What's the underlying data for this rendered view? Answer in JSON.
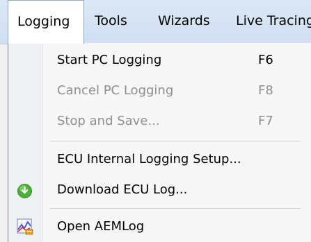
{
  "menubar": {
    "items": [
      {
        "label": "Logging"
      },
      {
        "label": "Tools"
      },
      {
        "label": "Wizards"
      },
      {
        "label": "Live Tracing"
      }
    ]
  },
  "menu": {
    "items": [
      {
        "label": "Start PC Logging",
        "shortcut": "F6",
        "enabled": true
      },
      {
        "label": "Cancel PC Logging",
        "shortcut": "F8",
        "enabled": false
      },
      {
        "label": "Stop and Save...",
        "shortcut": "F7",
        "enabled": false
      },
      {
        "label": "ECU Internal Logging Setup...",
        "enabled": true
      },
      {
        "label": "Download ECU Log...",
        "icon": "download-icon",
        "enabled": true
      },
      {
        "label": "Open AEMLog",
        "icon": "aemlog-icon",
        "enabled": true
      }
    ]
  },
  "colors": {
    "menubar_bg": "#d6e4f4",
    "menu_bg": "#f7f7f7",
    "disabled_text": "#8f8f8f",
    "download_icon": "#4caf3a"
  }
}
